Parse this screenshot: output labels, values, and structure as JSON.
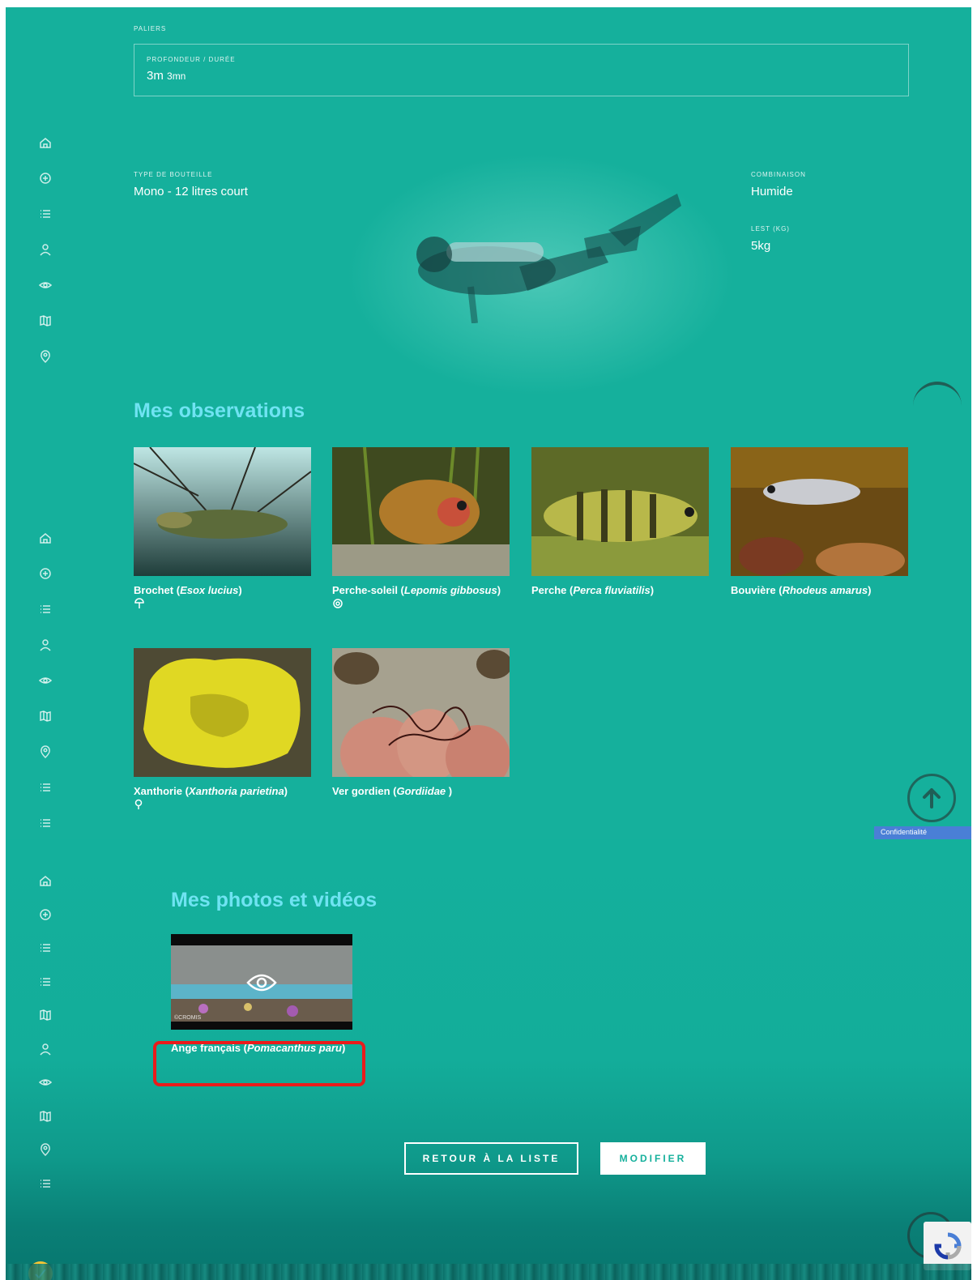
{
  "dive_details": {
    "paliers_label": "PALIERS",
    "profondeur_duree_label": "PROFONDEUR / DURÉE",
    "profondeur_value": "3m",
    "duree_value": "3mn",
    "bouteille_label": "TYPE DE BOUTEILLE",
    "bouteille_value": "Mono - 12 litres court",
    "combinaison_label": "COMBINAISON",
    "combinaison_value": "Humide",
    "lest_label": "LEST (KG)",
    "lest_value": "5kg"
  },
  "observations": {
    "title": "Mes observations",
    "items": [
      {
        "common": "Brochet",
        "latin": "Esox lucius",
        "tag_icon": "mushroom-icon"
      },
      {
        "common": "Perche-soleil",
        "latin": "Lepomis gibbosus",
        "tag_icon": "lifebuoy-icon"
      },
      {
        "common": "Perche",
        "latin": "Perca fluviatilis",
        "tag_icon": ""
      },
      {
        "common": "Bouvière",
        "latin": "Rhodeus amarus",
        "tag_icon": ""
      },
      {
        "common": "Xanthorie",
        "latin": "Xanthoria parietina",
        "tag_icon": "magnifier-icon"
      },
      {
        "common": "Ver gordien",
        "latin": "Gordiidae ",
        "tag_icon": ""
      }
    ]
  },
  "media": {
    "title": "Mes photos et vidéos",
    "video_credit": "©CROMIS",
    "video_caption_common": "Ange français",
    "video_caption_latin": "Pomacanthus paru"
  },
  "actions": {
    "back_label": "RETOUR À LA LISTE",
    "edit_label": "MODIFIER"
  },
  "privacy_label": "Confidentialité",
  "sidenav_icons_top": [
    "home-icon",
    "plus-circle-icon",
    "list-icon",
    "user-icon",
    "eye-icon",
    "map-icon",
    "pin-icon"
  ],
  "sidenav_icons_mid": [
    "home-icon",
    "plus-circle-icon",
    "list-icon",
    "user-icon",
    "eye-icon",
    "map-icon",
    "pin-icon",
    "list-icon",
    "list-icon"
  ],
  "sidenav_icons_bottom": [
    "home-icon",
    "plus-circle-icon",
    "list-icon",
    "list-icon",
    "map-icon",
    "user-icon",
    "eye-icon",
    "map-icon",
    "pin-icon",
    "list-icon"
  ],
  "colors": {
    "background": "#15b09c",
    "section_title": "#6fe3f2",
    "highlight": "#ea1b1b",
    "badge": "#f6c534"
  }
}
